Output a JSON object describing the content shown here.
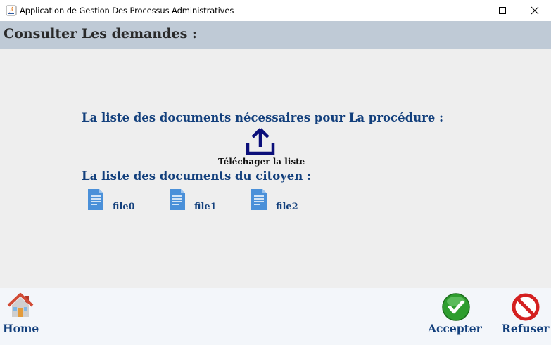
{
  "window": {
    "title": "Application de Gestion Des Processus Administratives"
  },
  "header": {
    "title": "Consulter Les demandes :"
  },
  "main": {
    "required_docs_label": "La liste des documents nécessaires pour La procédure :",
    "download_label": "Téléchager la liste",
    "citizen_docs_label": "La liste des documents du citoyen :",
    "files": [
      {
        "name": "file0",
        "icon": "document-icon"
      },
      {
        "name": "file1",
        "icon": "document-icon"
      },
      {
        "name": "file2",
        "icon": "document-icon"
      }
    ]
  },
  "footer": {
    "home_label": "Home",
    "accept_label": "Accepter",
    "refuse_label": "Refuser"
  },
  "colors": {
    "header_bg": "#bfcad6",
    "content_bg": "#eeeeee",
    "label_blue": "#123f7c",
    "accept_green": "#2e9d2e",
    "refuse_red": "#d42020"
  }
}
